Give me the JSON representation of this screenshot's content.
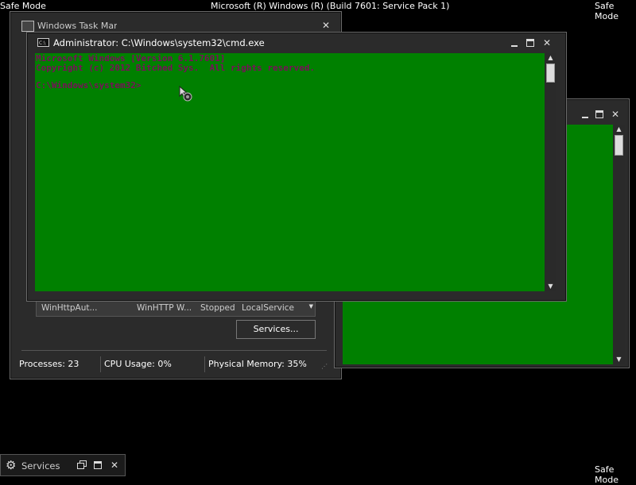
{
  "desktop": {
    "safe_mode_label": "Safe Mode",
    "build_banner": "Microsoft (R) Windows (R) (Build 7601: Service Pack 1)"
  },
  "task_manager": {
    "title": "Windows Task Manager",
    "row": {
      "name": "WinHttpAut...",
      "description": "WinHTTP W...",
      "status": "Stopped",
      "group": "LocalService"
    },
    "services_button": "Services...",
    "status_processes": "Processes: 23",
    "status_cpu": "CPU Usage: 0%",
    "status_memory": "Physical Memory: 35%"
  },
  "cmd_window": {
    "title": "Administrator: C:\\Windows\\system32\\cmd.exe",
    "icon_label": "C:\\",
    "line1": "Microsoft Windows [Version 6.1.7601]",
    "line2": "Copyright (c) 2012 Bitched Sys.  All rights reserved.",
    "prompt": "C:\\Windows\\system32>"
  },
  "taskbar": {
    "services_label": "Services"
  },
  "colors": {
    "console_bg": "#008000",
    "console_text": "#7a0f5a",
    "frame": "#2b2b2b"
  },
  "icons": [
    "cmd-icon",
    "minimize-icon",
    "maximize-icon",
    "close-icon",
    "gear-icon",
    "restore-icon",
    "scroll-up-icon",
    "scroll-down-icon",
    "resize-grip-icon"
  ]
}
